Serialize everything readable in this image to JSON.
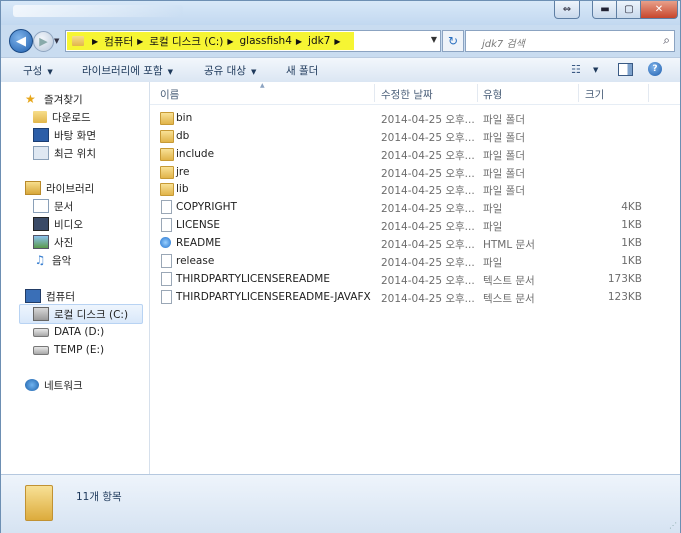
{
  "window": {
    "controls": {
      "restore_small": "⇔",
      "minimize": "▬",
      "maximize": "▢",
      "close": "✕"
    }
  },
  "nav": {
    "back": "◀",
    "forward": "▶",
    "breadcrumbs": [
      "컴퓨터",
      "로컬 디스크 (C:)",
      "glassfish4",
      "jdk7"
    ],
    "search_placeholder": "jdk7 검색",
    "highlight_color": "#f6f533"
  },
  "toolbar": {
    "organize": "구성",
    "include_in_library": "라이브러리에 포함",
    "share_with": "공유 대상",
    "new_folder": "새 폴더"
  },
  "sidebar": {
    "favorites": {
      "label": "즐겨찾기",
      "icon": "star-icon"
    },
    "favorites_items": [
      {
        "label": "다운로드",
        "icon": "downloads-icon"
      },
      {
        "label": "바탕 화면",
        "icon": "desktop-icon"
      },
      {
        "label": "최근 위치",
        "icon": "recent-places-icon"
      }
    ],
    "libraries": {
      "label": "라이브러리",
      "icon": "library-icon"
    },
    "libraries_items": [
      {
        "label": "문서",
        "icon": "documents-icon"
      },
      {
        "label": "비디오",
        "icon": "video-icon"
      },
      {
        "label": "사진",
        "icon": "pictures-icon"
      },
      {
        "label": "음악",
        "icon": "music-icon"
      }
    ],
    "computer": {
      "label": "컴퓨터",
      "icon": "computer-icon"
    },
    "computer_items": [
      {
        "label": "로컬 디스크 (C:)",
        "icon": "system-drive-icon",
        "selected": true
      },
      {
        "label": "DATA (D:)",
        "icon": "drive-icon"
      },
      {
        "label": "TEMP (E:)",
        "icon": "drive-icon"
      }
    ],
    "network": {
      "label": "네트워크",
      "icon": "network-icon"
    }
  },
  "columns": {
    "name": "이름",
    "date": "수정한 날짜",
    "type": "유형",
    "size": "크기"
  },
  "files": [
    {
      "name": "bin",
      "date": "2014-04-25 오후...",
      "type": "파일 폴더",
      "size": "",
      "icon": "folder"
    },
    {
      "name": "db",
      "date": "2014-04-25 오후...",
      "type": "파일 폴더",
      "size": "",
      "icon": "folder"
    },
    {
      "name": "include",
      "date": "2014-04-25 오후...",
      "type": "파일 폴더",
      "size": "",
      "icon": "folder"
    },
    {
      "name": "jre",
      "date": "2014-04-25 오후...",
      "type": "파일 폴더",
      "size": "",
      "icon": "folder"
    },
    {
      "name": "lib",
      "date": "2014-04-25 오후...",
      "type": "파일 폴더",
      "size": "",
      "icon": "folder"
    },
    {
      "name": "COPYRIGHT",
      "date": "2014-04-25 오후...",
      "type": "파일",
      "size": "4KB",
      "icon": "file"
    },
    {
      "name": "LICENSE",
      "date": "2014-04-25 오후...",
      "type": "파일",
      "size": "1KB",
      "icon": "file"
    },
    {
      "name": "README",
      "date": "2014-04-25 오후...",
      "type": "HTML 문서",
      "size": "1KB",
      "icon": "html"
    },
    {
      "name": "release",
      "date": "2014-04-25 오후...",
      "type": "파일",
      "size": "1KB",
      "icon": "file"
    },
    {
      "name": "THIRDPARTYLICENSEREADME",
      "date": "2014-04-25 오후...",
      "type": "텍스트 문서",
      "size": "173KB",
      "icon": "file"
    },
    {
      "name": "THIRDPARTYLICENSEREADME-JAVAFX",
      "date": "2014-04-25 오후...",
      "type": "텍스트 문서",
      "size": "123KB",
      "icon": "file"
    }
  ],
  "status": {
    "item_count": "11개 항목"
  }
}
